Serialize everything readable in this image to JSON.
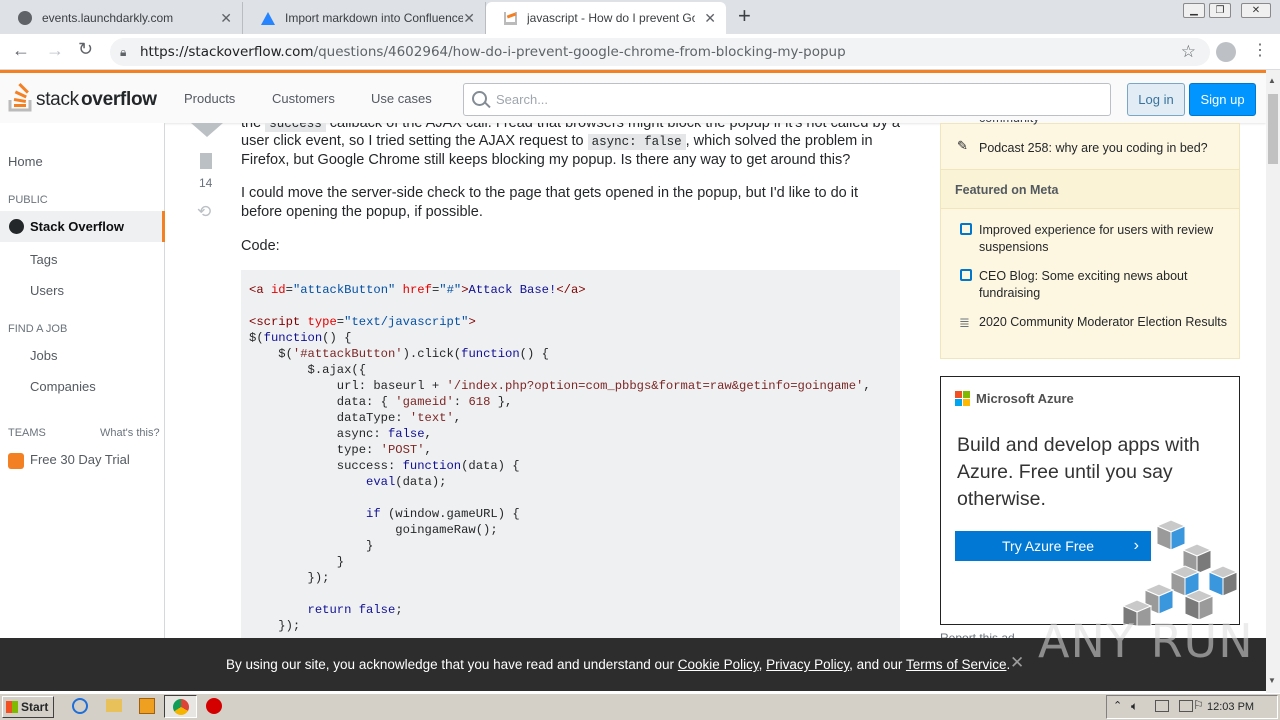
{
  "browser": {
    "tabs": [
      {
        "title": "events.launchdarkly.com"
      },
      {
        "title": "Import markdown into Confluence"
      },
      {
        "title": "javascript - How do I prevent Google"
      }
    ],
    "new_tab": "+",
    "url_domain": "https://stackoverflow.com",
    "url_path": "/questions/4602964/how-do-i-prevent-google-chrome-from-blocking-my-popup"
  },
  "header": {
    "logo_stack": "stack",
    "logo_overflow": "overflow",
    "nav": [
      "Products",
      "Customers",
      "Use cases"
    ],
    "search_placeholder": "Search...",
    "login": "Log in",
    "signup": "Sign up"
  },
  "sidebar": {
    "home": "Home",
    "public_label": "PUBLIC",
    "stack_overflow": "Stack Overflow",
    "tags": "Tags",
    "users": "Users",
    "find_job_label": "FIND A JOB",
    "jobs": "Jobs",
    "companies": "Companies",
    "teams_label": "TEAMS",
    "whats_this": "What's this?",
    "trial": "Free 30 Day Trial"
  },
  "question": {
    "bookmark_count": "14",
    "line1_a": "the",
    "line1_code": "success",
    "line1_b": "callback of the AJAX call. I read that browsers might block the popup if it's not called by a",
    "line2_a": "user click event, so I tried setting the AJAX request to",
    "line2_code": "async: false",
    "line2_b": ", which solved the problem in",
    "line3": "Firefox, but Google Chrome still keeps blocking my popup. Is there any way to get around this?",
    "para2": "I could move the server-side check to the page that gets opened in the popup, but I'd like to do it before opening the popup, if possible.",
    "code_label": "Code:"
  },
  "right": {
    "community_frag": "community",
    "podcast": "Podcast 258: why are you coding in bed?",
    "featured_meta": "Featured on Meta",
    "meta_items": [
      "Improved experience for users with review suspensions",
      "CEO Blog: Some exciting news about fundraising",
      "2020 Community Moderator Election Results"
    ],
    "ad_brand": "Microsoft Azure",
    "ad_headline": "Build and develop apps with Azure. Free until you say otherwise.",
    "ad_cta": "Try Azure Free",
    "report_frag": "Report this ad"
  },
  "cookie": {
    "text_a": "By using our site, you acknowledge that you have read and understand our ",
    "cookie_policy": "Cookie Policy",
    "sep1": ", ",
    "privacy_policy": "Privacy Policy",
    "text_b": ", and our ",
    "terms": "Terms of Service",
    "text_c": "."
  },
  "watermark": "ANY RUN",
  "taskbar": {
    "start": "Start",
    "clock": "12:03 PM"
  },
  "colors": {
    "accent": "#f48024",
    "link_blue": "#0077cc",
    "signup_bg": "#0095ff",
    "meta_bg": "#fdf7e2",
    "azure_blue": "#0078d4"
  }
}
